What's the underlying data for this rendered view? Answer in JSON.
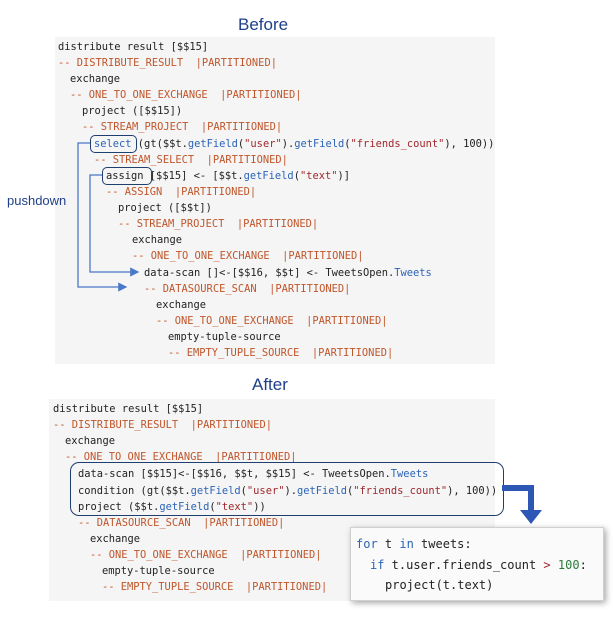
{
  "before_title": "Before",
  "after_title": "After",
  "pushdown_label": "pushdown",
  "before": {
    "l1": "distribute result [$$15]",
    "l2_op": "-- DISTRIBUTE_RESULT  |PARTITIONED|",
    "l3": "exchange",
    "l4_op": "-- ONE_TO_ONE_EXCHANGE  |PARTITIONED|",
    "l5": "project ([$$15])",
    "l6_op": "-- STREAM_PROJECT  |PARTITIONED|",
    "l7_kw": "select",
    "l7_a": " (gt($$t.",
    "l7_fn1": "getField",
    "l7_b": "(",
    "l7_s1": "\"user\"",
    "l7_c": ").",
    "l7_fn2": "getField",
    "l7_d": "(",
    "l7_s2": "\"friends_count\"",
    "l7_e": "), 100))",
    "l8_op": "-- STREAM_SELECT  |PARTITIONED|",
    "l9_kw": "assign",
    "l9_a": " [$$15] <- [$$t.",
    "l9_fn": "getField",
    "l9_b": "(",
    "l9_s": "\"text\"",
    "l9_c": ")]",
    "l10_op": "-- ASSIGN  |PARTITIONED|",
    "l11": "project ([$$t])",
    "l12_op": "-- STREAM_PROJECT  |PARTITIONED|",
    "l13": "exchange",
    "l14_op": "-- ONE_TO_ONE_EXCHANGE  |PARTITIONED|",
    "l15_a": "data-scan []<-[$$16, $$t] <- TweetsOpen.",
    "l15_fn": "Tweets",
    "l16_op": "-- DATASOURCE_SCAN  |PARTITIONED|",
    "l17": "exchange",
    "l18_op": "-- ONE_TO_ONE_EXCHANGE  |PARTITIONED|",
    "l19": "empty-tuple-source",
    "l20_op": "-- EMPTY_TUPLE_SOURCE  |PARTITIONED|"
  },
  "after": {
    "l1": "distribute result [$$15]",
    "l2_op": "-- DISTRIBUTE_RESULT  |PARTITIONED|",
    "l3": "exchange",
    "l4_op": "-- ONE_TO_ONE_EXCHANGE  |PARTITIONED|",
    "l5_a": "data-scan [$$15]<-[$$16, $$t, $$15] <- TweetsOpen.",
    "l5_fn": "Tweets",
    "l6_a": "condition (gt($$t.",
    "l6_fn1": "getField",
    "l6_b": "(",
    "l6_s1": "\"user\"",
    "l6_c": ").",
    "l6_fn2": "getField",
    "l6_d": "(",
    "l6_s2": "\"friends_count\"",
    "l6_e": "), 100))",
    "l7_a": "project ($$t.",
    "l7_fn": "getField",
    "l7_b": "(",
    "l7_s": "\"text\"",
    "l7_c": "))",
    "l8_op": "-- DATASOURCE_SCAN  |PARTITIONED|",
    "l9": "exchange",
    "l10_op": "-- ONE_TO_ONE_EXCHANGE  |PARTITIONED|",
    "l11": "empty-tuple-source",
    "l12_op": "-- EMPTY_TUPLE_SOURCE  |PARTITIONED|"
  },
  "python": {
    "p1_kw1": "for",
    "p1_a": " t ",
    "p1_kw2": "in",
    "p1_b": " tweets:",
    "p2_kw": "if",
    "p2_a": " t.user.friends_count ",
    "p2_op": ">",
    "p2_sp": " ",
    "p2_num": "100",
    "p2_b": ":",
    "p3": "project(t.text)"
  },
  "colors": {
    "accent": "#1f3f8a",
    "operator": "#c0552a",
    "function": "#2b63b6",
    "string": "#a0282d"
  }
}
